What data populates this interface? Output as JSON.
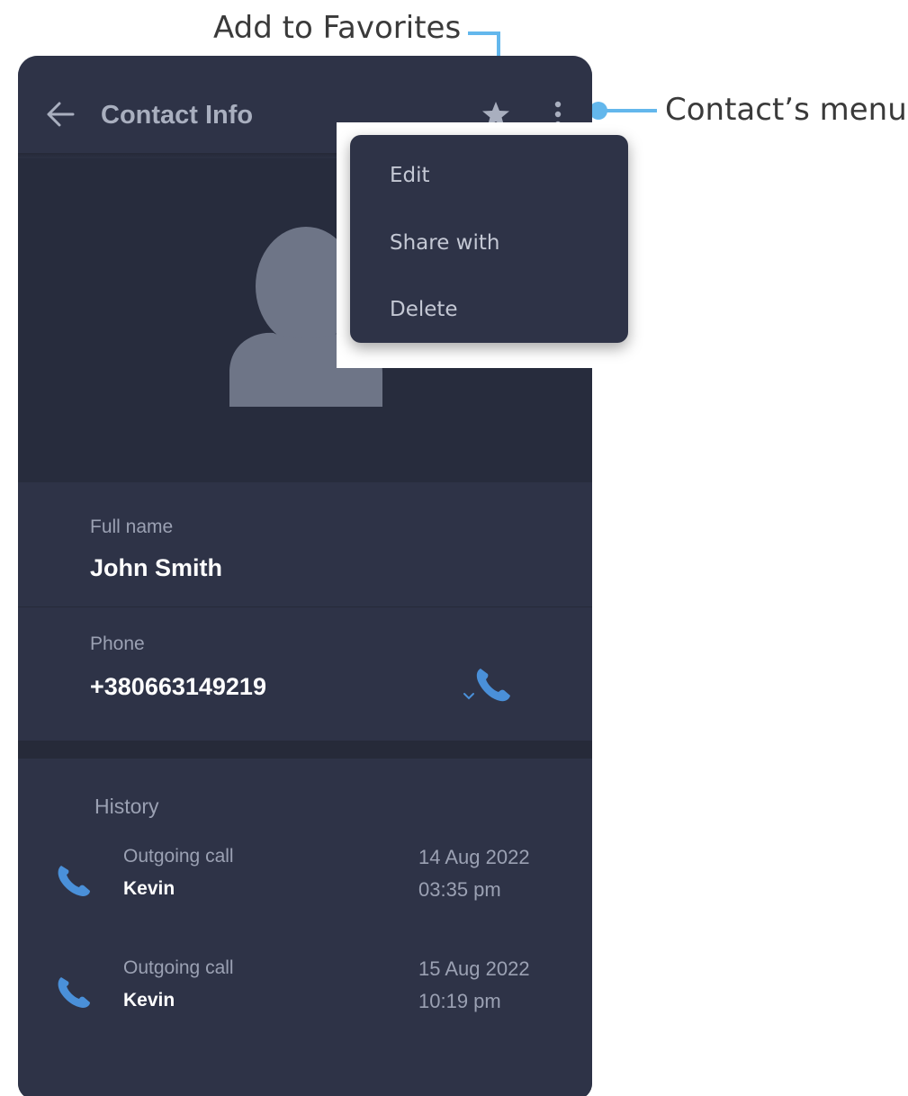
{
  "annotations": {
    "favorites": "Add to Favorites",
    "menu": "Contact’s menu"
  },
  "appbar": {
    "title": "Contact Info",
    "back_icon": "arrow-left-icon",
    "favorite_icon": "star-icon",
    "menu_icon": "more-vertical-icon"
  },
  "menu": {
    "items": [
      {
        "label": "Edit"
      },
      {
        "label": "Share with"
      },
      {
        "label": "Delete"
      }
    ]
  },
  "contact": {
    "full_name_label": "Full name",
    "full_name": "John Smith",
    "phone_label": "Phone",
    "phone": "+380663149219",
    "call_icon": "phone-icon"
  },
  "history": {
    "title": "History",
    "calls": [
      {
        "type": "Outgoing call",
        "name": "Kevin",
        "date": "14 Aug 2022",
        "time": "03:35 pm",
        "icon": "phone-icon"
      },
      {
        "type": "Outgoing call",
        "name": "Kevin",
        "date": "15 Aug 2022",
        "time": "10:19 pm",
        "icon": "phone-icon"
      }
    ]
  },
  "colors": {
    "panel": "#2e3347",
    "hero": "#272c3d",
    "accent": "#4a90d9",
    "callout": "#63b7ec"
  }
}
